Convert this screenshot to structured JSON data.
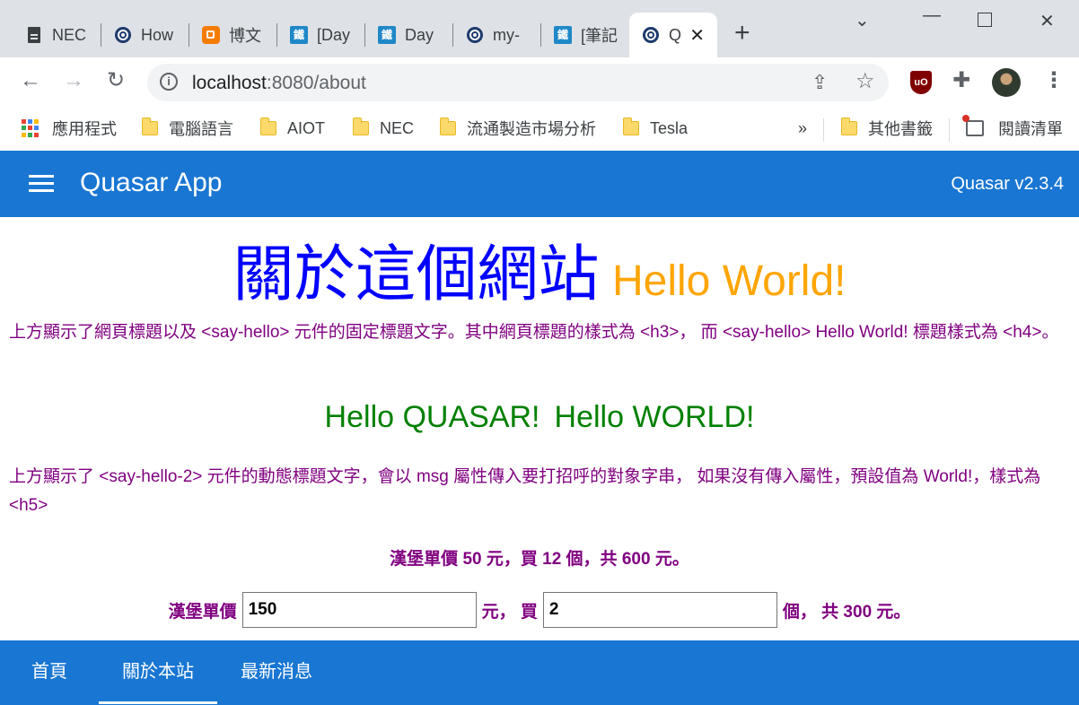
{
  "browser": {
    "tabs": [
      {
        "title": "NEC",
        "icon": "document-icon"
      },
      {
        "title": "How",
        "icon": "quasar-icon"
      },
      {
        "title": "博文",
        "icon": "blogger-icon"
      },
      {
        "title": "[Day",
        "icon": "ithome-icon"
      },
      {
        "title": "Day",
        "icon": "ithome-icon"
      },
      {
        "title": "my-",
        "icon": "quasar-icon"
      },
      {
        "title": "[筆記",
        "icon": "ithome-icon"
      },
      {
        "title": "Q",
        "icon": "quasar-icon",
        "active": true
      }
    ],
    "url_host": "localhost",
    "url_path": ":8080/about",
    "bookmarks": [
      "應用程式",
      "電腦語言",
      "AIOT",
      "NEC",
      "流通製造市場分析",
      "Tesla"
    ],
    "overflow": "»",
    "other_bookmarks": "其他書籤",
    "reading_list": "閱讀清單"
  },
  "app": {
    "title": "Quasar App",
    "version": "Quasar v2.3.4"
  },
  "content": {
    "heading_h3": "關於這個網站",
    "heading_h4": "Hello World!",
    "para1": "上方顯示了網頁標題以及 <say-hello> 元件的固定標題文字。其中網頁標題的樣式為 <h3>， 而 <say-hello> Hello World! 標題樣式為 <h4>。",
    "hello_quasar": "Hello QUASAR!",
    "hello_world": "Hello WORLD!",
    "para2": "上方顯示了 <say-hello-2> 元件的動態標題文字，會以 msg 屬性傳入要打招呼的對象字串， 如果沒有傳入屬性，預設值為 World!，樣式為 <h5>",
    "price_summary": "漢堡單價 50 元，買 12 個，共 600 元。",
    "form": {
      "price_label": "漢堡單價",
      "price_value": "150",
      "unit_label": "元， 買",
      "qty_value": "2",
      "total_label": "個， 共 300 元。"
    }
  },
  "footer_tabs": [
    {
      "label": "首頁"
    },
    {
      "label": "關於本站",
      "active": true
    },
    {
      "label": "最新消息"
    }
  ],
  "colors": {
    "primary": "#1976d2",
    "h3": "#0000ff",
    "h4": "#ffa500",
    "h5": "#008000",
    "paragraph": "#800080"
  }
}
